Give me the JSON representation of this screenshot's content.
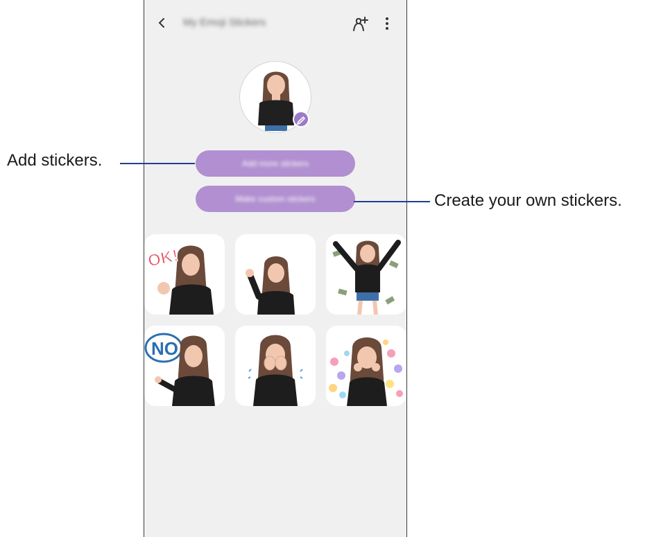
{
  "header": {
    "title": "My Emoji Stickers",
    "back_icon": "chevron-left-icon",
    "add_avatar_icon": "avatar-add-icon",
    "more_icon": "more-vertical-icon"
  },
  "profile": {
    "avatar_icon": "avatar-icon",
    "edit_icon": "pencil-icon"
  },
  "buttons": {
    "add_stickers_label": "Add more stickers",
    "custom_stickers_label": "Make custom stickers"
  },
  "stickers": [
    {
      "name": "ok-sticker",
      "text": "OK!"
    },
    {
      "name": "wave-sticker",
      "text": ""
    },
    {
      "name": "money-sticker",
      "text": ""
    },
    {
      "name": "no-sticker",
      "text": "NO"
    },
    {
      "name": "cover-face-sticker",
      "text": ""
    },
    {
      "name": "hearts-sticker",
      "text": ""
    }
  ],
  "callouts": {
    "add_stickers": "Add stickers.",
    "create_stickers": "Create your own stickers."
  },
  "colors": {
    "accent": "#b18fd0",
    "badge": "#9a7bc7",
    "callout_line": "#1f3f8f",
    "screen_bg": "#f0f0f0"
  }
}
